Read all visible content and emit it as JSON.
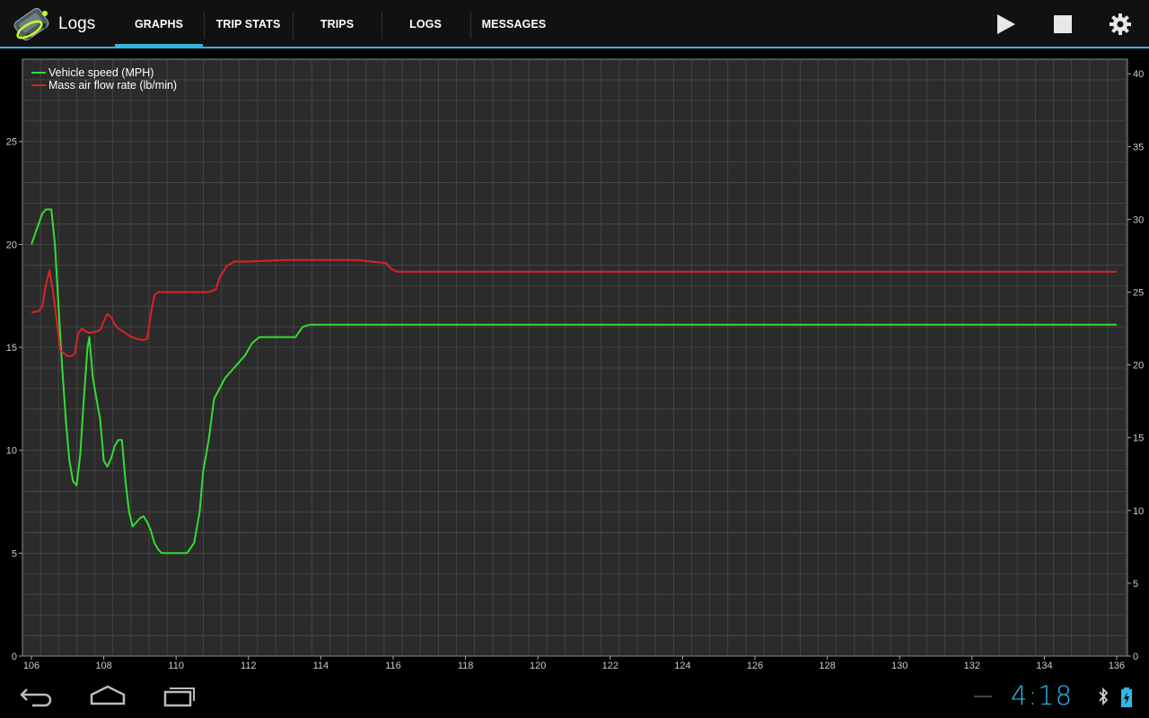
{
  "app": {
    "title": "Logs",
    "logo_icon": "car-obd-logo-icon"
  },
  "tabs": [
    {
      "label": "GRAPHS",
      "active": true
    },
    {
      "label": "TRIP STATS",
      "active": false
    },
    {
      "label": "TRIPS",
      "active": false
    },
    {
      "label": "LOGS",
      "active": false
    },
    {
      "label": "MESSAGES",
      "active": false
    }
  ],
  "toolbar": {
    "play_icon": "play-icon",
    "stop_icon": "stop-icon",
    "settings_icon": "gear-icon"
  },
  "chart_data": {
    "type": "line",
    "grid": true,
    "legend_position": "top-left",
    "x_ticks": [
      "106",
      "108",
      "110",
      "112",
      "114",
      "116",
      "118",
      "120",
      "122",
      "124",
      "126",
      "128",
      "130",
      "132",
      "134",
      "136"
    ],
    "xlim": [
      106,
      136
    ],
    "left_axis": {
      "ticks": [
        "0",
        "5",
        "10",
        "15",
        "20",
        "25"
      ],
      "lim": [
        0,
        29
      ]
    },
    "right_axis": {
      "ticks": [
        "0",
        "5",
        "10",
        "15",
        "20",
        "25",
        "30",
        "35",
        "40"
      ],
      "lim": [
        0,
        41
      ]
    },
    "series": [
      {
        "name": "Vehicle speed (MPH)",
        "color": "#33dd33",
        "axis": "left",
        "points": [
          [
            106.0,
            20.0
          ],
          [
            106.1,
            20.5
          ],
          [
            106.2,
            21.0
          ],
          [
            106.3,
            21.5
          ],
          [
            106.4,
            21.7
          ],
          [
            106.55,
            21.7
          ],
          [
            106.65,
            20.0
          ],
          [
            106.75,
            17.0
          ],
          [
            106.85,
            14.0
          ],
          [
            106.95,
            11.5
          ],
          [
            107.05,
            9.5
          ],
          [
            107.15,
            8.5
          ],
          [
            107.25,
            8.3
          ],
          [
            107.35,
            9.8
          ],
          [
            107.45,
            12.5
          ],
          [
            107.55,
            15.0
          ],
          [
            107.6,
            15.5
          ],
          [
            107.7,
            13.5
          ],
          [
            107.8,
            12.5
          ],
          [
            107.9,
            11.5
          ],
          [
            108.0,
            9.5
          ],
          [
            108.1,
            9.2
          ],
          [
            108.2,
            9.6
          ],
          [
            108.3,
            10.2
          ],
          [
            108.4,
            10.5
          ],
          [
            108.5,
            10.5
          ],
          [
            108.6,
            8.5
          ],
          [
            108.7,
            7.0
          ],
          [
            108.8,
            6.3
          ],
          [
            108.9,
            6.5
          ],
          [
            109.0,
            6.7
          ],
          [
            109.1,
            6.8
          ],
          [
            109.2,
            6.5
          ],
          [
            109.3,
            6.1
          ],
          [
            109.4,
            5.5
          ],
          [
            109.5,
            5.2
          ],
          [
            109.6,
            5.0
          ],
          [
            110.0,
            5.0
          ],
          [
            110.3,
            5.0
          ],
          [
            110.5,
            5.5
          ],
          [
            110.65,
            7.0
          ],
          [
            110.75,
            9.0
          ],
          [
            110.9,
            10.5
          ],
          [
            111.05,
            12.5
          ],
          [
            111.2,
            13.0
          ],
          [
            111.35,
            13.5
          ],
          [
            111.5,
            13.8
          ],
          [
            111.7,
            14.2
          ],
          [
            111.9,
            14.6
          ],
          [
            112.1,
            15.2
          ],
          [
            112.3,
            15.5
          ],
          [
            113.0,
            15.5
          ],
          [
            113.3,
            15.5
          ],
          [
            113.5,
            16.0
          ],
          [
            113.7,
            16.1
          ],
          [
            114.5,
            16.1
          ],
          [
            120.0,
            16.1
          ],
          [
            128.0,
            16.1
          ],
          [
            136.0,
            16.1
          ]
        ]
      },
      {
        "name": "Mass air flow rate (lb/min)",
        "color": "#dd2222",
        "axis": "right",
        "points": [
          [
            106.0,
            23.6
          ],
          [
            106.2,
            23.7
          ],
          [
            106.3,
            24.0
          ],
          [
            106.4,
            25.5
          ],
          [
            106.5,
            26.5
          ],
          [
            106.6,
            25.0
          ],
          [
            106.7,
            23.0
          ],
          [
            106.8,
            21.0
          ],
          [
            106.9,
            20.8
          ],
          [
            107.0,
            20.6
          ],
          [
            107.1,
            20.6
          ],
          [
            107.2,
            20.8
          ],
          [
            107.3,
            22.2
          ],
          [
            107.4,
            22.5
          ],
          [
            107.5,
            22.3
          ],
          [
            107.6,
            22.2
          ],
          [
            107.8,
            22.3
          ],
          [
            107.9,
            22.4
          ],
          [
            108.0,
            23.0
          ],
          [
            108.1,
            23.5
          ],
          [
            108.2,
            23.3
          ],
          [
            108.3,
            22.8
          ],
          [
            108.4,
            22.5
          ],
          [
            108.6,
            22.2
          ],
          [
            108.7,
            22.0
          ],
          [
            108.9,
            21.8
          ],
          [
            109.1,
            21.7
          ],
          [
            109.2,
            21.8
          ],
          [
            109.3,
            23.5
          ],
          [
            109.4,
            24.8
          ],
          [
            109.5,
            25.0
          ],
          [
            110.0,
            25.0
          ],
          [
            110.5,
            25.0
          ],
          [
            110.9,
            25.0
          ],
          [
            111.1,
            25.2
          ],
          [
            111.2,
            26.0
          ],
          [
            111.4,
            26.8
          ],
          [
            111.6,
            27.1
          ],
          [
            112.0,
            27.1
          ],
          [
            113.0,
            27.2
          ],
          [
            114.0,
            27.2
          ],
          [
            115.0,
            27.2
          ],
          [
            115.4,
            27.1
          ],
          [
            115.8,
            27.0
          ],
          [
            115.95,
            26.6
          ],
          [
            116.1,
            26.4
          ],
          [
            117.0,
            26.4
          ],
          [
            120.0,
            26.4
          ],
          [
            128.0,
            26.4
          ],
          [
            136.0,
            26.4
          ]
        ]
      }
    ]
  },
  "navbar": {
    "back_icon": "back-icon",
    "home_icon": "home-icon",
    "recents_icon": "recent-apps-icon"
  },
  "status": {
    "time": "4:18",
    "bluetooth_icon": "bluetooth-icon",
    "battery_icon": "battery-charging-icon"
  }
}
